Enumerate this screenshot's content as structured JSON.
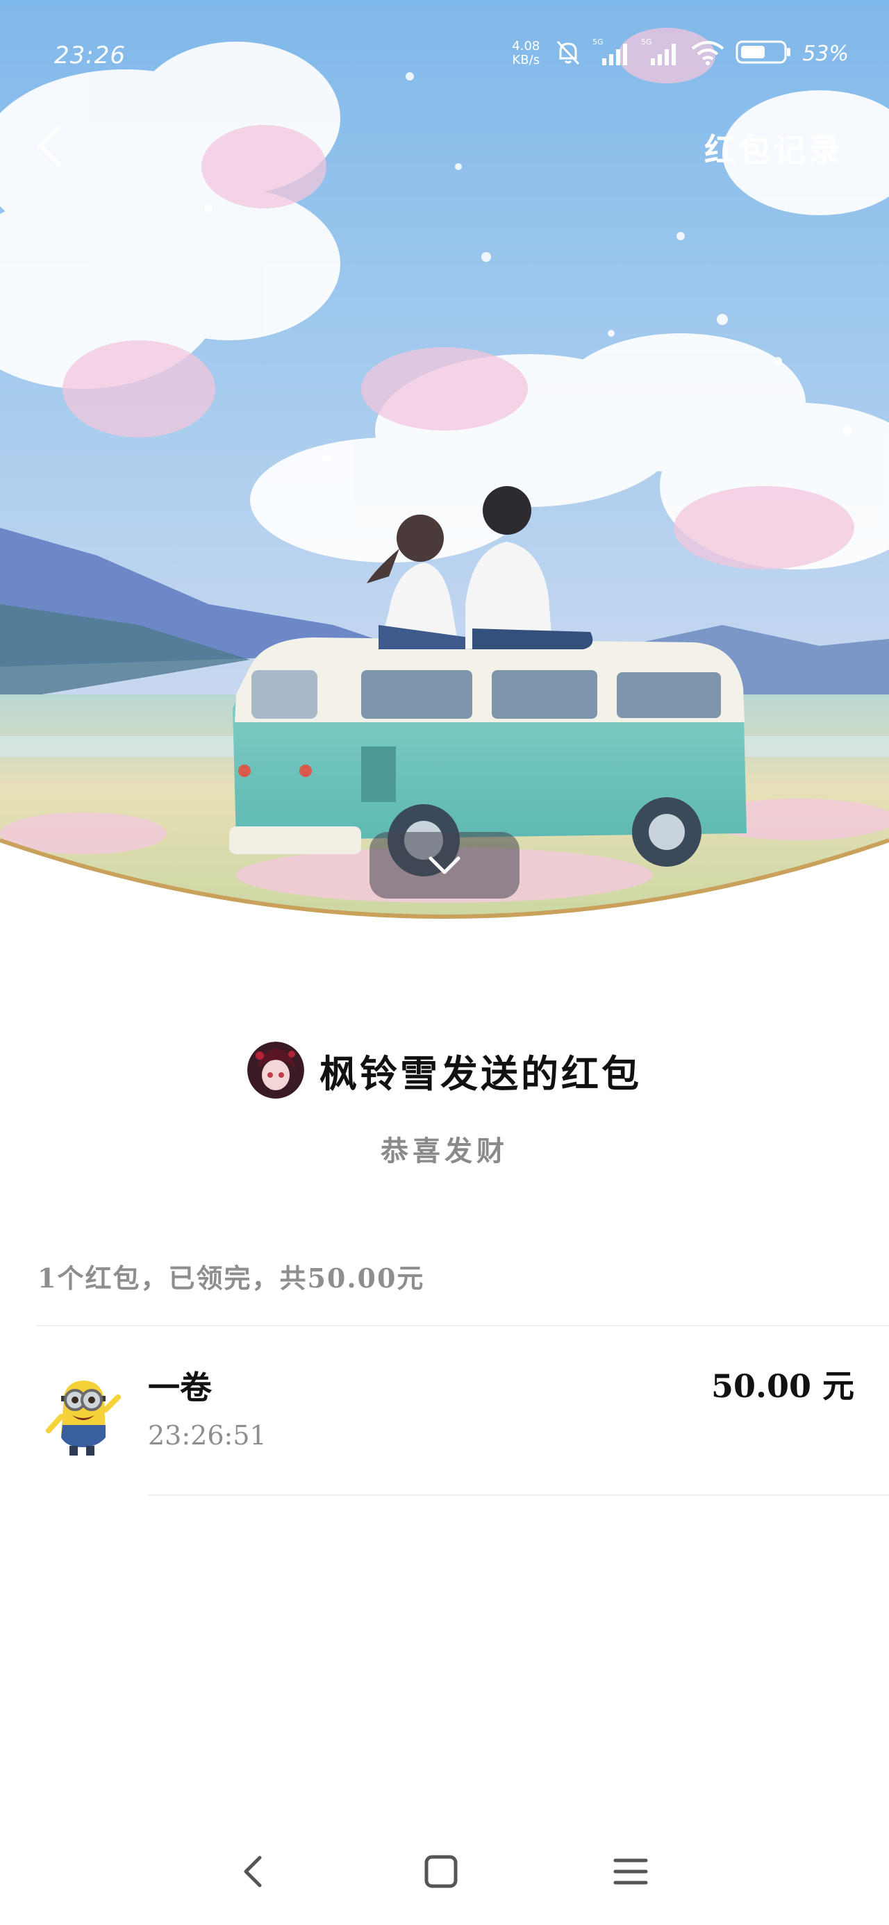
{
  "status_bar": {
    "time": "23:26",
    "net_speed_value": "4.08",
    "net_speed_unit": "KB/s",
    "battery": "53%"
  },
  "nav": {
    "record_label": "红包记录"
  },
  "envelope": {
    "sender_title": "枫铃雪发送的红包",
    "greeting": "恭喜发财",
    "summary": "1个红包，已领完，共50.00元"
  },
  "claims": [
    {
      "name": "一卷",
      "time": "23:26:51",
      "amount": "50.00 元"
    }
  ],
  "colors": {
    "gold_arc": "#c9a15a",
    "text_primary": "#111111",
    "text_secondary": "#8e8e8e"
  },
  "icons": {
    "back": "chevron-left-icon",
    "collapse": "chevron-down-icon",
    "sys_back": "nav-back-icon",
    "sys_home": "nav-home-icon",
    "sys_menu": "nav-menu-icon"
  }
}
